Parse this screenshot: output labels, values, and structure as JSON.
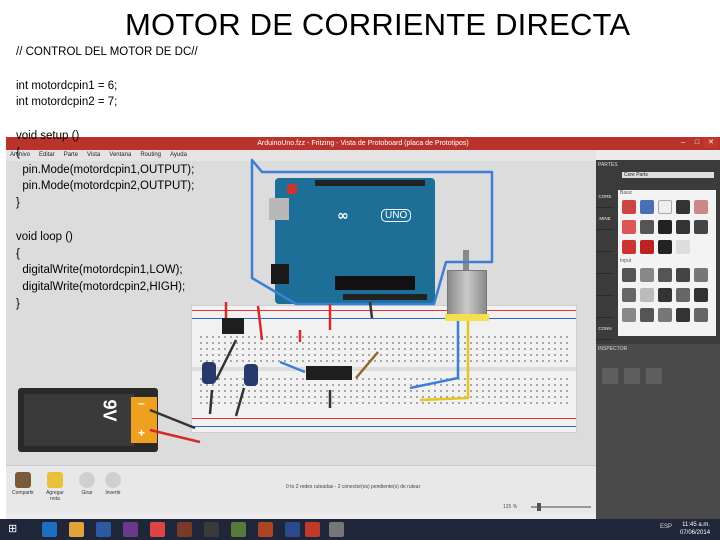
{
  "slide": {
    "title": "MOTOR DE CORRIENTE DIRECTA",
    "code": [
      "// CONTROL DEL MOTOR DE DC//",
      "",
      "int motordcpin1 = 6;",
      "int motordcpin2 = 7;",
      "",
      "void setup ()",
      "{",
      "  pin.Mode(motordcpin1,OUTPUT);",
      "  pin.Mode(motordcpin2,OUTPUT);",
      "}",
      "",
      "void loop ()",
      "{",
      "  digitalWrite(motordcpin1,LOW);",
      "  digitalWrite(motordcpin2,HIGH);",
      "}"
    ]
  },
  "window": {
    "title": "ArduinoUno.fzz - Fritzing - Vista de Protoboard (placa de Prototipos)",
    "min": "–",
    "max": "□",
    "close": "✕"
  },
  "menu": [
    "Archivo",
    "Editar",
    "Parte",
    "Vista",
    "Ventana",
    "Routing",
    "Ayuda"
  ],
  "toolbar": {
    "tools": [
      "Compartir",
      "Agregar nota",
      "Girar",
      "Invertir"
    ],
    "status": "0 to 2 redes ruteadas - 2 conector(es) pendiente(s) de rutear",
    "zoom": "125 %"
  },
  "board": {
    "logo": "∞",
    "uno": "UNO"
  },
  "battery": {
    "voltage": "9V",
    "minus": "–",
    "plus": "+"
  },
  "parts_panel": {
    "header": "PARTES",
    "search_label": "Core Parts",
    "section_core": "CORE",
    "section_mine": "MINE",
    "section_basic": "Basic",
    "section_input": "Input",
    "tabs": [
      "CORE",
      "MINE",
      "",
      "",
      "",
      "",
      "",
      "",
      "CONN",
      "TRIB"
    ],
    "inspector": "INSPECTOR"
  },
  "taskbar": {
    "start": "⊞",
    "lang": "ESP",
    "time": "11:45 a.m.",
    "date": "07/06/2014"
  },
  "colors": {
    "title_bar": "#b9322c",
    "arduino": "#1d6f98",
    "wire_blue": "#3d7fd6",
    "wire_red": "#d42a2a",
    "wire_yellow": "#e8c420",
    "battery_label": "#f0a020"
  }
}
